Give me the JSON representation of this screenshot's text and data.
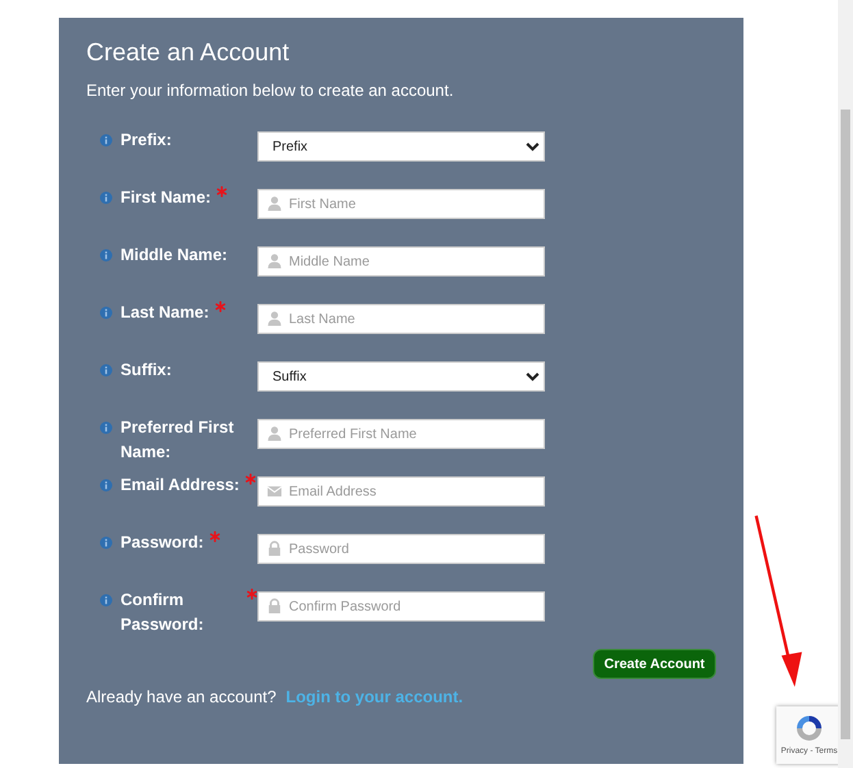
{
  "form": {
    "title": "Create an Account",
    "subtitle": "Enter your information below to create an account.",
    "fields": [
      {
        "label": "Prefix:",
        "kind": "select",
        "value": "Prefix",
        "required": false
      },
      {
        "label": "First Name:",
        "kind": "name",
        "placeholder": "First Name",
        "required": true
      },
      {
        "label": "Middle Name:",
        "kind": "name",
        "placeholder": "Middle Name",
        "required": false
      },
      {
        "label": "Last Name:",
        "kind": "name",
        "placeholder": "Last Name",
        "required": true
      },
      {
        "label": "Suffix:",
        "kind": "select",
        "value": "Suffix",
        "required": false
      },
      {
        "label": "Preferred First Name:",
        "kind": "name",
        "placeholder": "Preferred First Name",
        "required": false
      },
      {
        "label": "Email Address:",
        "kind": "email",
        "placeholder": "Email Address",
        "required": true
      },
      {
        "label": "Password:",
        "kind": "password",
        "placeholder": "Password",
        "required": true
      },
      {
        "label": "Confirm Password:",
        "kind": "password",
        "placeholder": "Confirm Password",
        "required": true
      }
    ],
    "submit": "Create Account",
    "footer_text": "Already have an account?",
    "login_link": "Login to your account."
  },
  "recaptcha": {
    "text": "Privacy - Terms"
  }
}
